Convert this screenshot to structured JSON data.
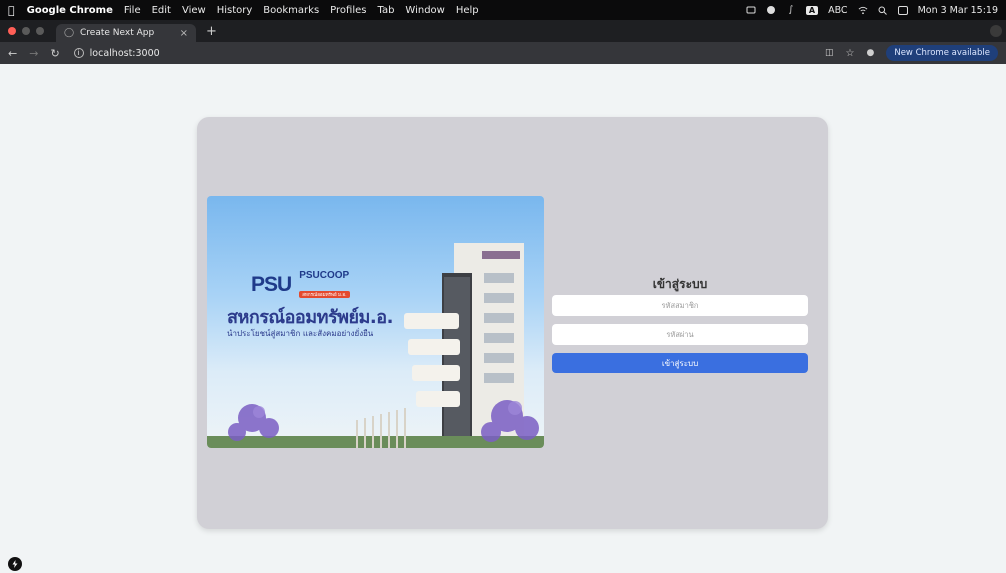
{
  "menubar": {
    "app_name": "Google Chrome",
    "items": [
      "File",
      "Edit",
      "View",
      "History",
      "Bookmarks",
      "Profiles",
      "Tab",
      "Window",
      "Help"
    ],
    "input_badge": "A",
    "input_label": "ABC",
    "datetime": "Mon 3 Mar 15:19"
  },
  "tab": {
    "title": "Create Next App",
    "close": "×",
    "new_tab": "+"
  },
  "toolbar": {
    "url": "localhost:3000",
    "update_label": "New Chrome available"
  },
  "hero": {
    "logo_text": "PSU",
    "coop_name": "PSUCOOP",
    "coop_tagline": "สหกรณ์ออมทรัพย์ ม.อ.",
    "title": "สหกรณ์ออมทรัพย์ม.อ.",
    "subtitle": "นำประโยชน์สู่สมาชิก และสังคมอย่างยั่งยืน"
  },
  "login": {
    "title": "เข้าสู่ระบบ",
    "member_placeholder": "รหัสสมาชิก",
    "password_placeholder": "รหัสผ่าน",
    "submit_label": "เข้าสู่ระบบ"
  },
  "colors": {
    "primary_button": "#3a6fe0",
    "card_bg": "#d1d0d6",
    "page_bg": "#f1f4f5"
  }
}
